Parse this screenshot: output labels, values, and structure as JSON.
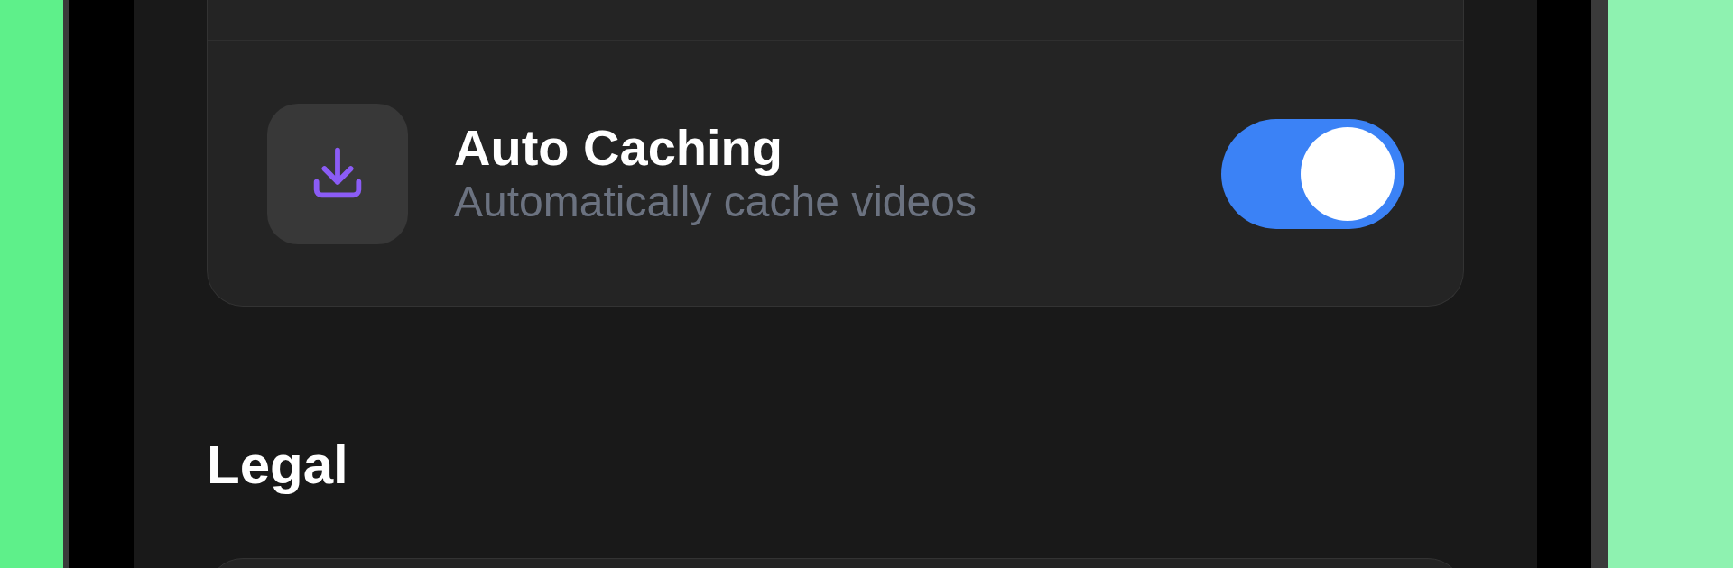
{
  "settings_card": {
    "rows": [
      {
        "kind": "toggle",
        "title": "Auto Caching",
        "subtitle": "Automatically cache videos",
        "on": true
      }
    ]
  },
  "legal_section": {
    "title": "Legal"
  }
}
